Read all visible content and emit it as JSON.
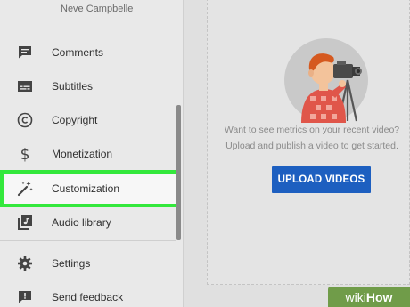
{
  "sidebar": {
    "user_name": "Neve Campbelle",
    "items": [
      {
        "label": "Comments",
        "icon": "comment-icon"
      },
      {
        "label": "Subtitles",
        "icon": "subtitles-icon"
      },
      {
        "label": "Copyright",
        "icon": "copyright-icon"
      },
      {
        "label": "Monetization",
        "icon": "dollar-icon"
      },
      {
        "label": "Customization",
        "icon": "magic-wand-icon",
        "active": true
      },
      {
        "label": "Audio library",
        "icon": "music-library-icon"
      }
    ],
    "footer_items": [
      {
        "label": "Settings",
        "icon": "gear-icon"
      },
      {
        "label": "Send feedback",
        "icon": "feedback-icon"
      }
    ]
  },
  "main": {
    "prompt_line1": "Want to see metrics on your recent video?",
    "prompt_line2": "Upload and publish a video to get started.",
    "upload_button": "UPLOAD VIDEOS"
  },
  "watermark": {
    "part1": "wiki",
    "part2": "How"
  },
  "colors": {
    "highlight": "#33e83c",
    "button": "#1d5fc0",
    "background": "#e9e9e9"
  }
}
